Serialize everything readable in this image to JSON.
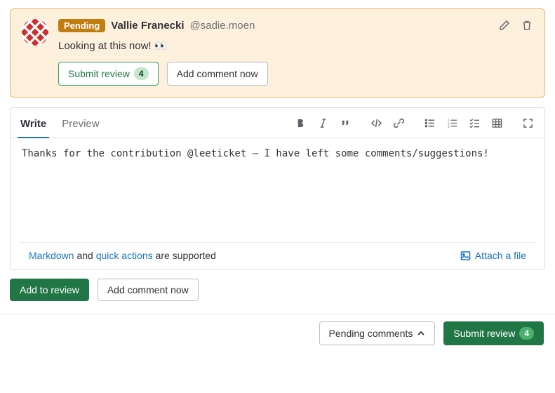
{
  "pending": {
    "badge": "Pending",
    "author_name": "Vallie Franecki",
    "author_handle": "@sadie.moen",
    "body": "Looking at this now! 👀",
    "submit_label": "Submit review",
    "submit_count": "4",
    "add_comment_label": "Add comment now"
  },
  "editor": {
    "tabs": {
      "write": "Write",
      "preview": "Preview"
    },
    "content": "Thanks for the contribution @leeticket – I have left some comments/suggestions!",
    "footer": {
      "markdown_link": "Markdown",
      "and": " and ",
      "quick_actions_link": "quick actions",
      "supported": " are supported",
      "attach": "Attach a file"
    }
  },
  "actions": {
    "add_to_review": "Add to review",
    "add_comment_now": "Add comment now"
  },
  "footer": {
    "pending_comments": "Pending comments",
    "submit_review": "Submit review",
    "submit_count": "4"
  }
}
